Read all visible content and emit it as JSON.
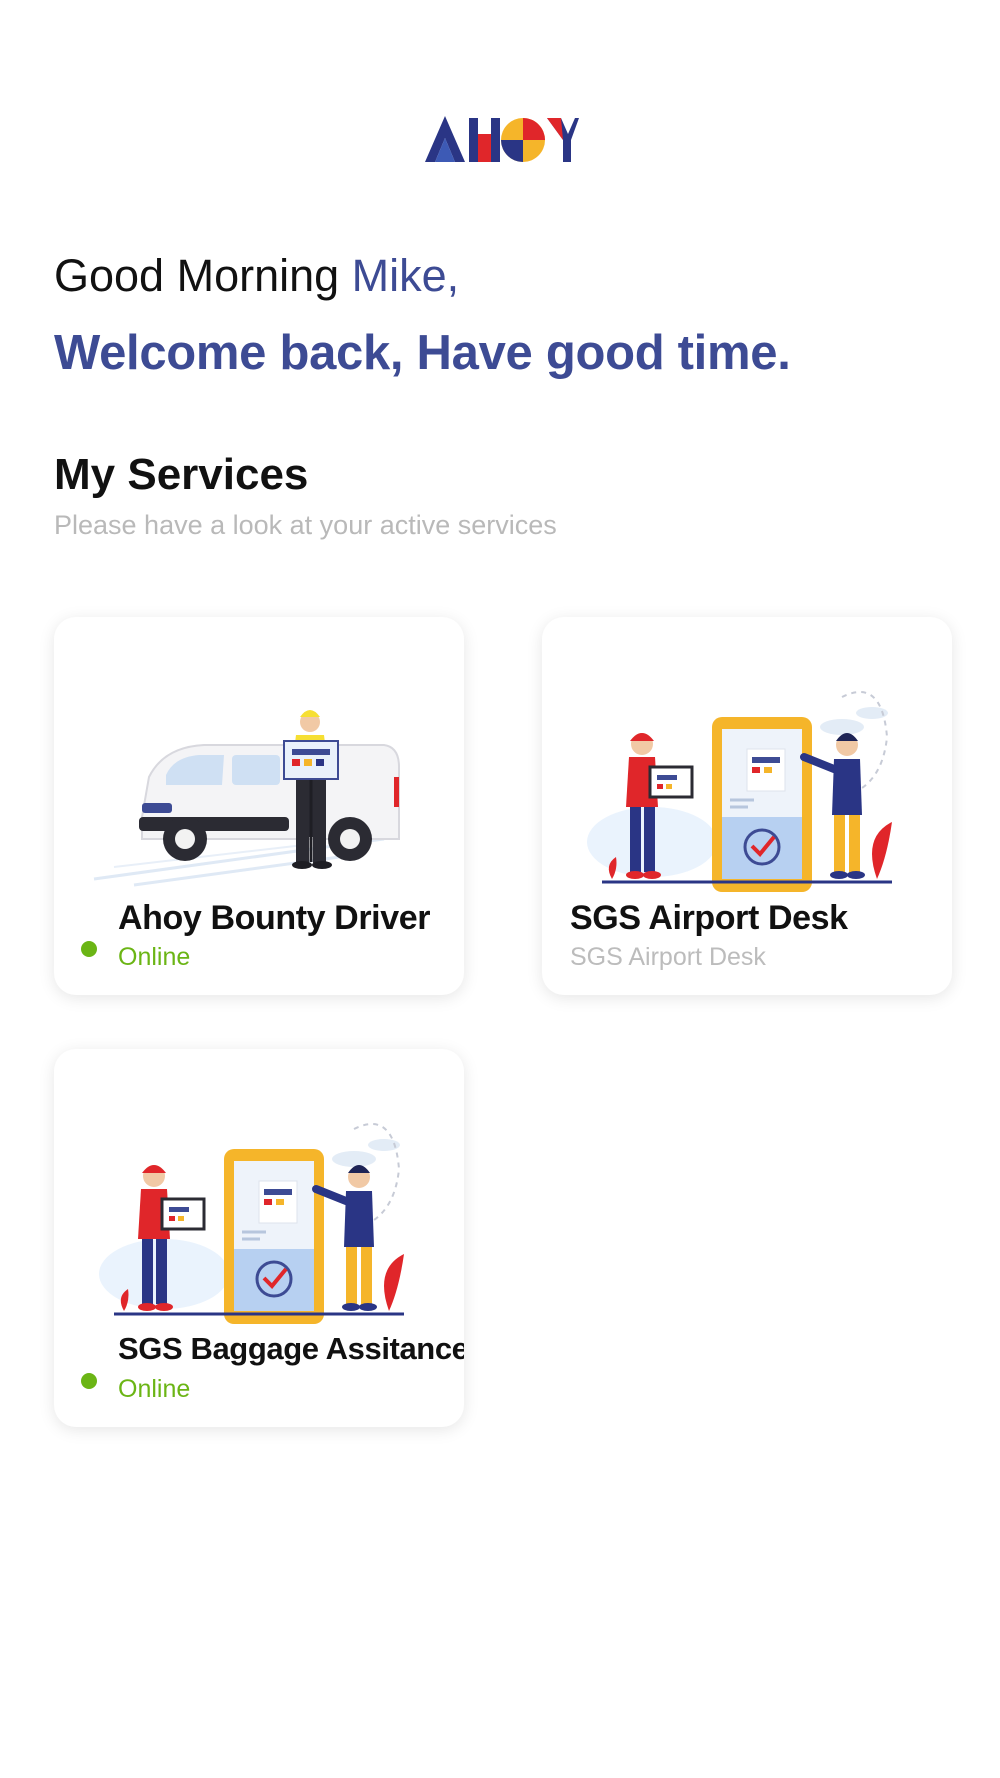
{
  "brand": {
    "logo_text": "AHOY"
  },
  "header": {
    "greeting": "Good Morning ",
    "user_name": "Mike,",
    "welcome": "Welcome back, Have good time."
  },
  "services": {
    "title": "My Services",
    "subtitle": "Please have a look at your active services",
    "items": [
      {
        "title": "Ahoy Bounty Driver",
        "status": "Online",
        "illustration": "delivery-van-icon"
      },
      {
        "title": "SGS Airport Desk",
        "status": "SGS Airport Desk",
        "illustration": "airport-desk-icon"
      },
      {
        "title": "SGS Baggage Assitance",
        "status": "Online",
        "illustration": "baggage-assist-icon"
      }
    ]
  },
  "colors": {
    "accent": "#3d4b94",
    "online": "#6bb515",
    "muted": "#b9b9b9"
  }
}
